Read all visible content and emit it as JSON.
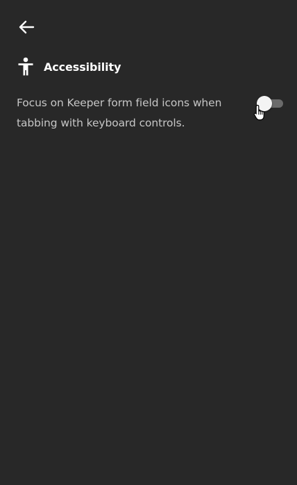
{
  "header": {
    "back_icon": "arrow-left-icon"
  },
  "section": {
    "icon": "accessibility-person-icon",
    "title": "Accessibility"
  },
  "setting": {
    "description": "Focus on Keeper form field icons when tabbing with keyboard controls.",
    "toggle_on": false
  },
  "pointer": {
    "icon": "hand-pointer-cursor-icon"
  },
  "colors": {
    "background": "#282828",
    "text_primary": "#ffffff",
    "text_secondary": "#c6c6c6",
    "toggle_track": "#6b6b6b",
    "toggle_knob": "#f4f4f4"
  }
}
